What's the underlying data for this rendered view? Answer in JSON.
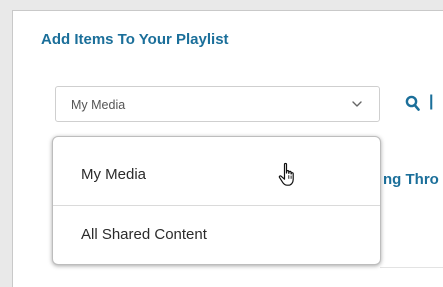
{
  "dialog": {
    "title": "Add Items To Your Playlist"
  },
  "source_select": {
    "selected_value": "My Media",
    "options": [
      "My Media",
      "All Shared Content"
    ],
    "chevron_icon": "chevron-down-icon"
  },
  "search": {
    "icon": "search-icon",
    "separator": "|"
  },
  "background": {
    "partial_link_text": "ng Thro"
  },
  "cursor": {
    "icon": "hand-pointer-icon"
  },
  "colors": {
    "accent": "#1b6f9a",
    "text": "#2b2b2b",
    "muted_text": "#555555"
  }
}
